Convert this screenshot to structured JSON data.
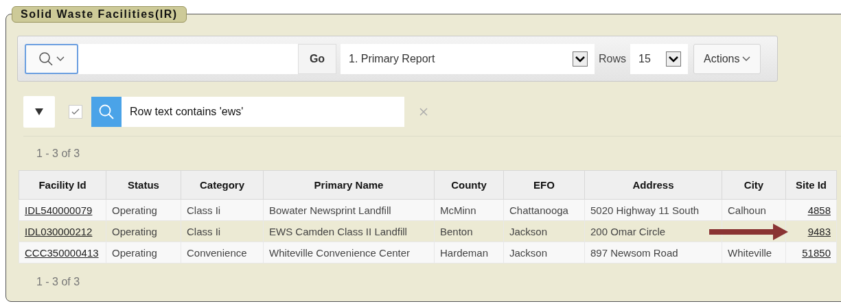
{
  "region": {
    "title": "Solid Waste Facilities(IR)"
  },
  "toolbar": {
    "go_button": "Go",
    "report_select": "1. Primary Report",
    "rows_label": "Rows",
    "rows_select": "15",
    "actions_button": "Actions"
  },
  "filter": {
    "expanded": true,
    "enabled": true,
    "text": "Row text contains 'ews'"
  },
  "pagination_top": "1 - 3 of 3",
  "table": {
    "columns": [
      {
        "label": "Facility Id",
        "kind": "link"
      },
      {
        "label": "Status",
        "kind": "text"
      },
      {
        "label": "Category",
        "kind": "text"
      },
      {
        "label": "Primary Name",
        "kind": "text"
      },
      {
        "label": "County",
        "kind": "text"
      },
      {
        "label": "EFO",
        "kind": "text"
      },
      {
        "label": "Address",
        "kind": "text"
      },
      {
        "label": "City",
        "kind": "text"
      },
      {
        "label": "Site Id",
        "kind": "number-link"
      }
    ],
    "rows": [
      {
        "highlighted": false,
        "cells": [
          {
            "text": "IDL540000079"
          },
          {
            "text": "Operating"
          },
          {
            "text": "Class Ii"
          },
          {
            "text": "Bowater Newsprint Landfill"
          },
          {
            "text": "McMinn"
          },
          {
            "text": "Chattanooga"
          },
          {
            "text": "5020 Highway 11 South"
          },
          {
            "text": "Calhoun"
          },
          {
            "text": "4858"
          }
        ]
      },
      {
        "highlighted": true,
        "cells": [
          {
            "text": "IDL030000212"
          },
          {
            "text": "Operating"
          },
          {
            "text": "Class Ii"
          },
          {
            "text": "EWS Camden Class II Landfill"
          },
          {
            "text": "Benton"
          },
          {
            "text": "Jackson"
          },
          {
            "text": "200 Omar Circle"
          },
          {
            "kind": "arrow"
          },
          {
            "text": "9483"
          }
        ]
      },
      {
        "highlighted": false,
        "cells": [
          {
            "text": "CCC350000413"
          },
          {
            "text": "Operating"
          },
          {
            "text": "Convenience"
          },
          {
            "text": "Whiteville Convenience Center"
          },
          {
            "text": "Hardeman"
          },
          {
            "text": "Jackson"
          },
          {
            "text": "897 Newsom Road"
          },
          {
            "text": "Whiteville"
          },
          {
            "text": "51850"
          }
        ]
      }
    ]
  },
  "pagination_bottom": "1 - 3 of 3"
}
